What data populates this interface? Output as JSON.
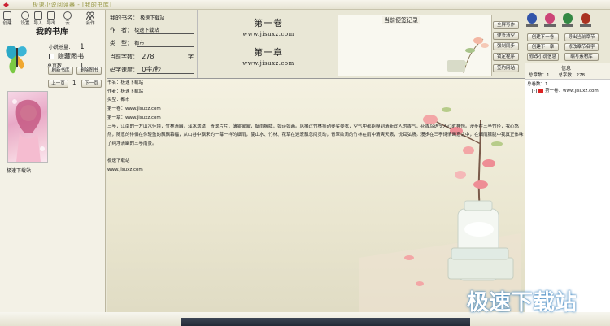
{
  "window": {
    "title": "极速小说阅读器 - [我的书库]"
  },
  "toolbar": [
    {
      "label": "创建"
    },
    {
      "label": "设置"
    },
    {
      "label": "导入"
    },
    {
      "label": "导出"
    },
    {
      "label": "云"
    },
    {
      "label": "会作"
    }
  ],
  "library": {
    "title": "我的书库",
    "total_label": "小说总量：",
    "total_value": "1",
    "hide_label": "隐藏图书",
    "pages_label": "总页数：",
    "pages_value": "1",
    "refresh_label": "刷新书库",
    "delete_label": "删除图书",
    "prev_label": "上一页",
    "page_value": "1",
    "next_label": "下一页",
    "book_caption": "极速下载站"
  },
  "bookinfo": {
    "name_label": "我的书名：",
    "name_value": "极速下载站",
    "author_label": "作　者：",
    "author_value": "极速下载站",
    "type_label": "类　型：",
    "type_value": "都市",
    "wordcount_label": "当前字数：",
    "wordcount_value": "278",
    "wordcount_unit": "字",
    "speed_label": "码字速度：",
    "speed_value": "0字/秒"
  },
  "chapter": {
    "volume": "第一卷",
    "volume_url": "www.jisuxz.com",
    "chapter": "第一章",
    "chapter_url": "www.jisuxz.com"
  },
  "notes": {
    "title": "当前便签记录",
    "buttons": [
      "全屏写作",
      "便签清空",
      "强制同步",
      "锁定程序",
      "签约网站"
    ]
  },
  "right_buttons": [
    {
      "label": "创建下一卷"
    },
    {
      "label": "导出当前章节"
    },
    {
      "label": "创建下一章"
    },
    {
      "label": "修改章节名字"
    },
    {
      "label": "修改小说信息"
    },
    {
      "label": "编写素材库"
    }
  ],
  "avatars": [
    {
      "color": "#3355aa"
    },
    {
      "color": "#cc4477"
    },
    {
      "color": "#338844"
    },
    {
      "color": "#aa3322"
    }
  ],
  "tree": {
    "header": "信息",
    "subheader": "总章数：1　　总字数：278",
    "root": "总卷数：1",
    "item": "第一卷：www.jisuxz.com"
  },
  "content": {
    "lines": [
      "书名：极速下载站",
      "作者：极速下载站",
      "类型：都市",
      "第一卷：www.jisuxz.com",
      "第一章：www.jisuxz.com",
      "三亭，江南的一方山水佳境，竹林清幽，溪水潺潺，青翠片片，薄雾蒙蒙，烟雨朦胧，如诗如画。风拂过竹林摇动婆娑琴弦，空气中都能嗅到清新宜人的香气，花香鸟语令人心旷神怡。漫步在三亭竹径，我心悠",
      "然，随意的徘徊在你轻盈的飘飘幕幅，从山谷中飘来的一幕一样的烟雨，使山水、竹林、花草在迷宏飘忽间灵动，青翠欲滴的竹林在雨中清爽天籁，悦耳弘扬。漫步在三亭诗情画意之中，在烟雨朦胧中我真正体味",
      "了纯净清幽的三亭雨景。",
      "",
      "极速下载站",
      "www.jisuxz.com"
    ]
  },
  "watermark": "极速下载站"
}
